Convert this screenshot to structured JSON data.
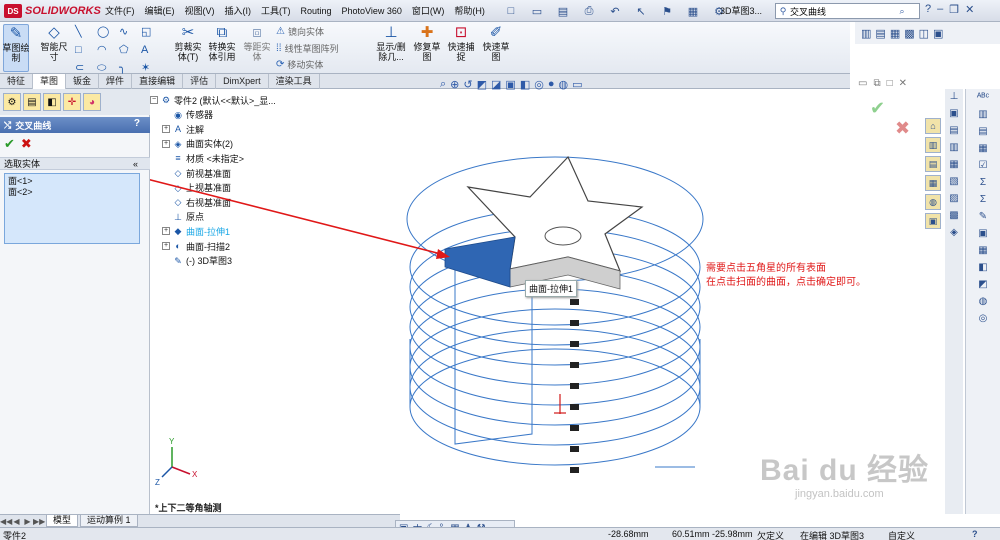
{
  "app": {
    "brand": "SOLIDWORKS",
    "brand_badge": "DS",
    "document_title": "3D草图3..."
  },
  "menu": [
    "文件(F)",
    "编辑(E)",
    "视图(V)",
    "插入(I)",
    "工具(T)",
    "Routing",
    "PhotoView 360",
    "窗口(W)",
    "帮助(H)"
  ],
  "search": {
    "value": "交叉曲线"
  },
  "commands": {
    "sketch": "草图绘\n制",
    "smart_dim": "智能尺\n寸",
    "trim": "剪裁实\n体(T)",
    "convert": "转换实\n体引用",
    "offset": "等距实\n体",
    "mirror": "镜向实体",
    "linear_pattern": "线性草图阵列",
    "move": "移动实体",
    "show_delete": "显示/删\n除几...",
    "repair": "修复草\n图",
    "quick_snaps": "快速捕\n捉",
    "rapid_sketch": "快速草\n图"
  },
  "tabs": [
    "特征",
    "草图",
    "钣金",
    "焊件",
    "直接编辑",
    "评估",
    "DimXpert",
    "渲染工具"
  ],
  "active_tab": "草图",
  "property_manager": {
    "title": "交叉曲线",
    "help": "?",
    "ok": "✔",
    "cancel": "✖",
    "section_title": "选取实体",
    "section_chevron": "«",
    "selections": [
      "面<1>",
      "面<2>"
    ]
  },
  "tree": [
    {
      "label": "零件2  (默认<<默认>_显...",
      "expander": "⊟",
      "icon": "⚙",
      "selected": false
    },
    {
      "label": "传感器",
      "expander": "",
      "icon": "◉",
      "selected": false
    },
    {
      "label": "注解",
      "expander": "⊞",
      "icon": "A",
      "selected": false
    },
    {
      "label": "曲面实体(2)",
      "expander": "⊞",
      "icon": "◈",
      "selected": false
    },
    {
      "label": "材质 <未指定>",
      "expander": "",
      "icon": "≡",
      "selected": false
    },
    {
      "label": "前视基准面",
      "expander": "",
      "icon": "◇",
      "selected": false
    },
    {
      "label": "上视基准面",
      "expander": "",
      "icon": "◇",
      "selected": false
    },
    {
      "label": "右视基准面",
      "expander": "",
      "icon": "◇",
      "selected": false
    },
    {
      "label": "原点",
      "expander": "",
      "icon": "⊥",
      "selected": false
    },
    {
      "label": "曲面-拉伸1",
      "expander": "⊞",
      "icon": "◆",
      "selected": true
    },
    {
      "label": "曲面-扫描2",
      "expander": "⊞",
      "icon": "◐",
      "selected": false
    },
    {
      "label": "(-) 3D草图3",
      "expander": "",
      "icon": "✎",
      "selected": false
    }
  ],
  "viewport": {
    "tooltip": "曲面-拉伸1",
    "annotation_line1": "需要点击五角星的所有表面",
    "annotation_line2": "在点击扫面的曲面，点击确定即可。",
    "view_name": "*上下二等角轴测",
    "watermark": "Bai du 经验",
    "watermark_url": "jingyan.baidu.com",
    "accent": "#3a78c8",
    "annotation_color": "#e01818"
  },
  "bottom_tabs": [
    "模型",
    "运动算例 1"
  ],
  "active_bottom_tab": "模型",
  "status": {
    "doc": "零件2",
    "x": "-28.68mm",
    "y": "60.51mm",
    "z": "-25.98mm",
    "state": "欠定义",
    "editing": "在编辑 3D草图3",
    "custom": "自定义",
    "help": "?"
  }
}
